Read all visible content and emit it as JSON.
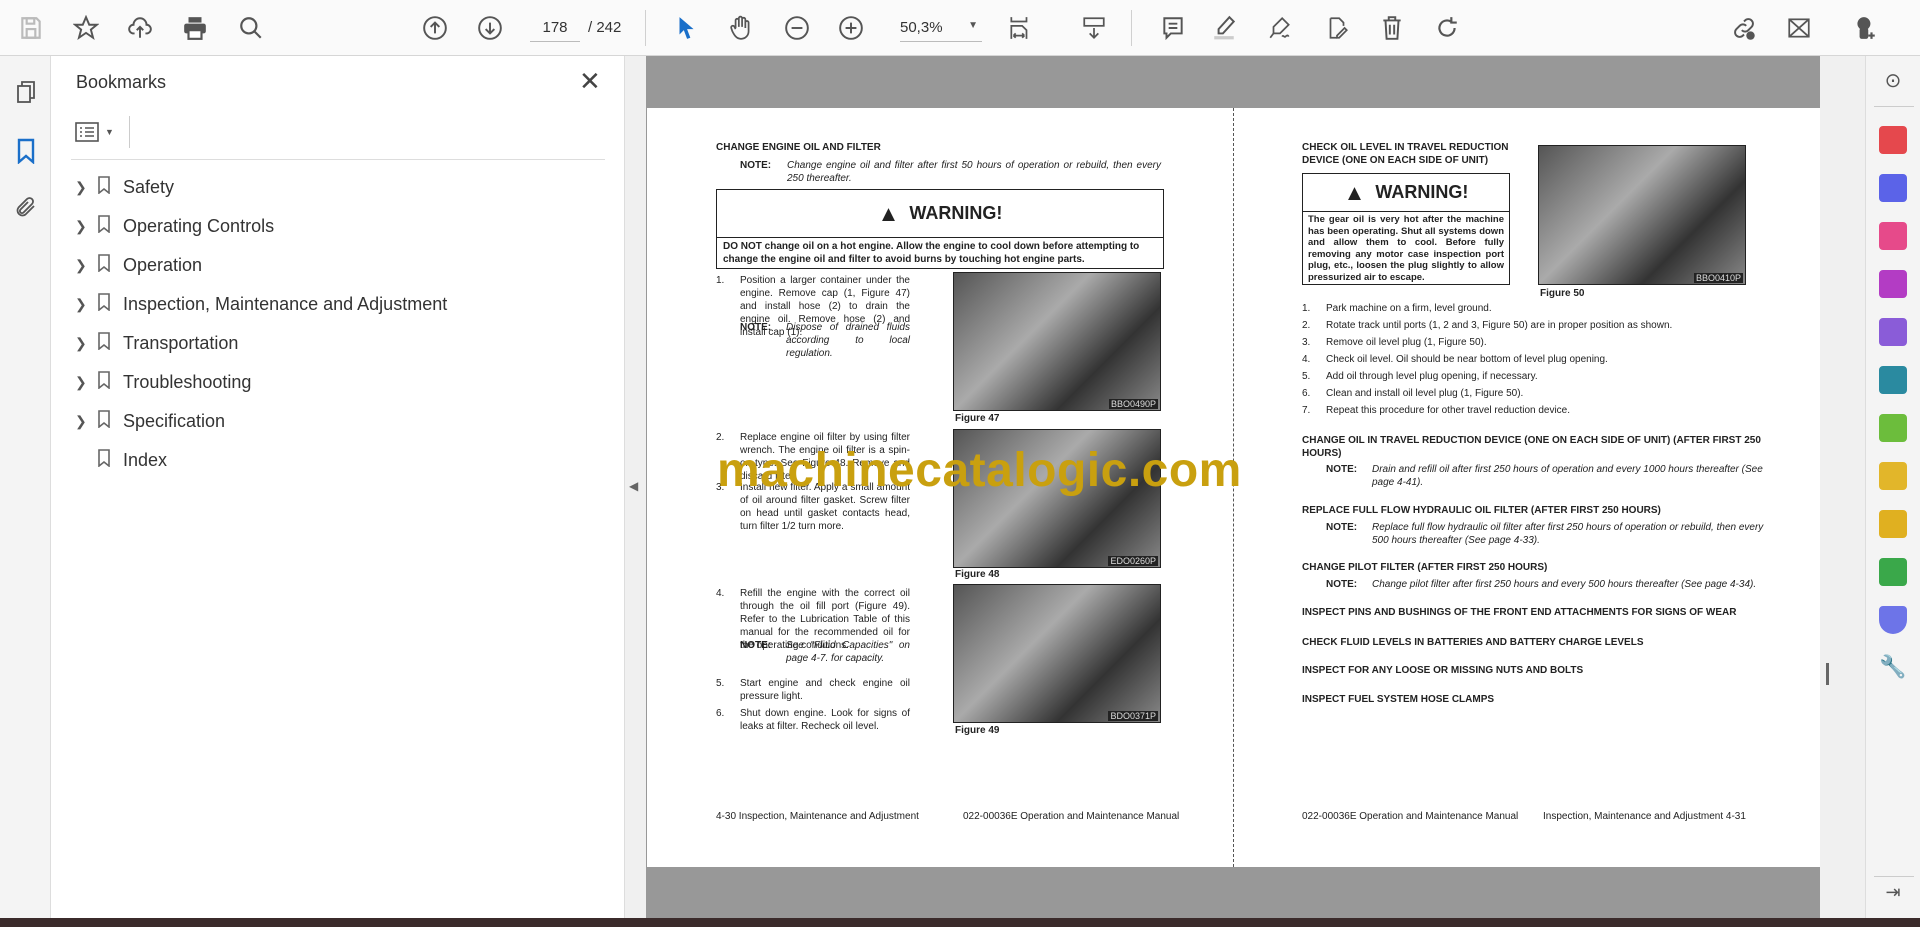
{
  "toolbar": {
    "page_current": "178",
    "page_total": "/ 242",
    "zoom": "50,3%"
  },
  "bookmarks": {
    "title": "Bookmarks",
    "items": [
      {
        "label": "Safety",
        "expandable": true
      },
      {
        "label": "Operating Controls",
        "expandable": true
      },
      {
        "label": "Operation",
        "expandable": true
      },
      {
        "label": "Inspection, Maintenance and Adjustment",
        "expandable": true
      },
      {
        "label": "Transportation",
        "expandable": true
      },
      {
        "label": "Troubleshooting",
        "expandable": true
      },
      {
        "label": "Specification",
        "expandable": true
      },
      {
        "label": "Index",
        "expandable": false
      }
    ]
  },
  "watermark": "machinecatalogic.com",
  "left_page": {
    "heading": "CHANGE ENGINE OIL AND FILTER",
    "note_label": "NOTE:",
    "note": "Change engine oil and filter after first 50 hours of operation or rebuild, then every 250 thereafter.",
    "warning_title": "WARNING!",
    "warning_text": "DO NOT change oil on a hot engine. Allow the engine to cool down before attempting to change the engine oil and filter to avoid burns by touching hot engine parts.",
    "steps": [
      {
        "n": "1.",
        "text": "Position a larger container under the engine. Remove cap (1, Figure 47) and install hose (2) to drain the engine oil. Remove hose (2) and install cap (1)."
      },
      {
        "n": "2.",
        "text": "Replace engine oil filter by using filter wrench. The engine oil filter is a spin-on type. See Figure 48. Remove and discard filter."
      },
      {
        "n": "3.",
        "text": "Install new filter. Apply a small amount of oil around filter gasket. Screw filter on head until gasket contacts head, turn filter 1/2 turn more."
      },
      {
        "n": "4.",
        "text": "Refill the engine with the correct oil through the oil fill port (Figure 49). Refer to the Lubrication Table of this manual for the recommended oil for the operating conditions."
      },
      {
        "n": "5.",
        "text": "Start engine and check engine oil pressure light."
      },
      {
        "n": "6.",
        "text": "Shut down engine. Look for signs of leaks at filter. Recheck oil level."
      }
    ],
    "note1": "Dispose of drained fluids according to local regulation.",
    "note4": "See \"Fluid Capacities\" on page 4-7. for capacity.",
    "figures": [
      {
        "label": "Figure 47",
        "code": "BBO0490P"
      },
      {
        "label": "Figure 48",
        "code": "EDO0260P"
      },
      {
        "label": "Figure 49",
        "code": "BDO0371P"
      }
    ],
    "footer_left": "4-30  Inspection, Maintenance and Adjustment",
    "footer_right": "022-00036E Operation and Maintenance Manual"
  },
  "right_page": {
    "heading": "CHECK OIL LEVEL IN TRAVEL REDUCTION DEVICE (ONE ON EACH SIDE OF UNIT)",
    "warning_title": "WARNING!",
    "warning_text": "The gear oil is very hot after the machine has been operating. Shut all systems down and allow them to cool. Before fully removing any motor case inspection port plug, etc., loosen the plug slightly to allow pressurized air to escape.",
    "figure": {
      "label": "Figure 50",
      "code": "BBO0410P"
    },
    "steps": [
      {
        "n": "1.",
        "text": "Park machine on a firm, level ground."
      },
      {
        "n": "2.",
        "text": "Rotate track until ports (1, 2 and 3, Figure 50) are in proper position as shown."
      },
      {
        "n": "3.",
        "text": "Remove oil level plug (1, Figure 50)."
      },
      {
        "n": "4.",
        "text": "Check oil level. Oil should be near bottom of level plug opening."
      },
      {
        "n": "5.",
        "text": "Add oil through level plug opening, if necessary."
      },
      {
        "n": "6.",
        "text": "Clean and install oil level plug (1, Figure 50)."
      },
      {
        "n": "7.",
        "text": "Repeat this procedure for other travel reduction device."
      }
    ],
    "sections": [
      {
        "heading": "CHANGE OIL IN TRAVEL REDUCTION DEVICE (ONE ON EACH SIDE OF UNIT) (AFTER FIRST 250 HOURS)",
        "note": "Drain and refill oil after first 250 hours of operation and every 1000 hours thereafter (See page 4-41)."
      },
      {
        "heading": "REPLACE FULL FLOW HYDRAULIC OIL FILTER (AFTER FIRST 250 HOURS)",
        "note": "Replace full flow hydraulic oil filter after first 250 hours of operation or rebuild, then every 500 hours thereafter (See page 4-33)."
      },
      {
        "heading": "CHANGE PILOT FILTER (AFTER FIRST 250 HOURS)",
        "note": "Change pilot filter after first 250 hours and every 500 hours thereafter (See page 4-34)."
      },
      {
        "heading": "INSPECT PINS AND BUSHINGS OF THE FRONT END ATTACHMENTS FOR SIGNS OF WEAR"
      },
      {
        "heading": "CHECK FLUID LEVELS IN BATTERIES AND BATTERY CHARGE LEVELS"
      },
      {
        "heading": "INSPECT FOR ANY LOOSE OR MISSING NUTS AND BOLTS"
      },
      {
        "heading": "INSPECT FUEL SYSTEM HOSE CLAMPS"
      }
    ],
    "note_label": "NOTE:",
    "footer_left": "022-00036E Operation and Maintenance Manual",
    "footer_right": "Inspection, Maintenance and Adjustment 4-31"
  }
}
